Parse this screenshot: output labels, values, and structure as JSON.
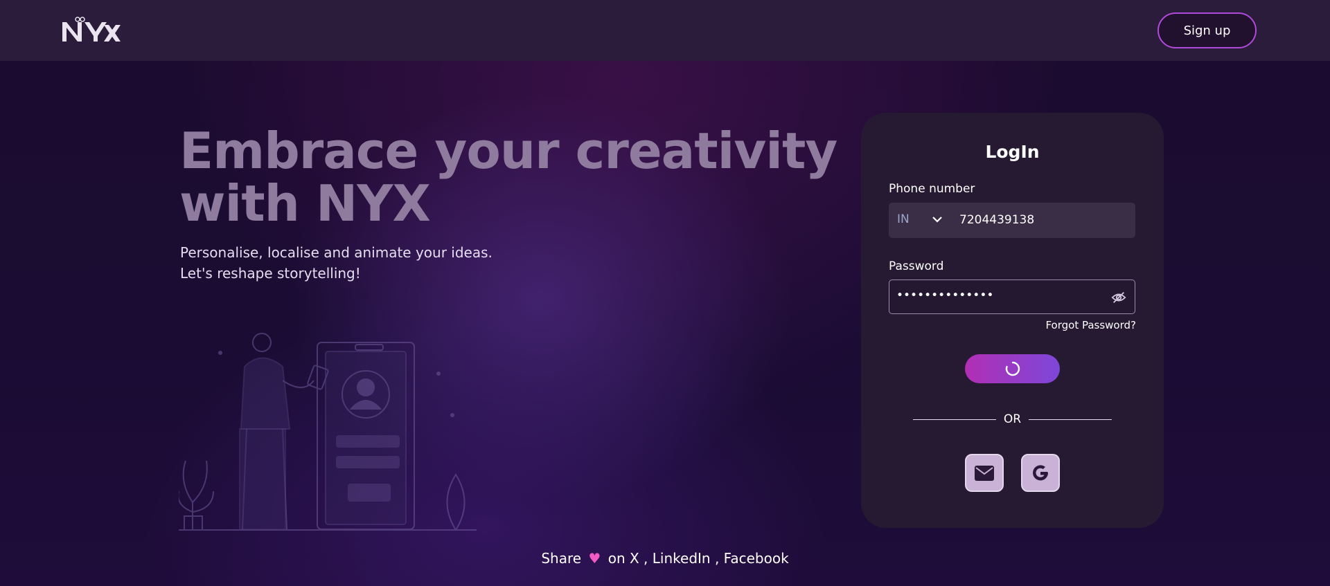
{
  "header": {
    "logo_text": "NYX",
    "signup_label": "Sign up"
  },
  "hero": {
    "title": "Embrace your creativity with NYX",
    "subtitle_line1": "Personalise, localise and animate your ideas.",
    "subtitle_line2": "Let's reshape storytelling!"
  },
  "login": {
    "title": "LogIn",
    "phone_label": "Phone number",
    "country_code": "IN",
    "phone_value": "7204439138",
    "password_label": "Password",
    "password_value": "••••••••••••••",
    "forgot_label": "Forgot Password?",
    "or_label": "OR"
  },
  "footer": {
    "share_label": "Share",
    "heart_icon": "♥",
    "on_label": "on",
    "links": [
      "X",
      "LinkedIn",
      "Facebook"
    ],
    "separator": ","
  },
  "colors": {
    "accent_pink": "#b12fb4",
    "accent_violet": "#7d47d8",
    "heart": "#f25bc4"
  }
}
